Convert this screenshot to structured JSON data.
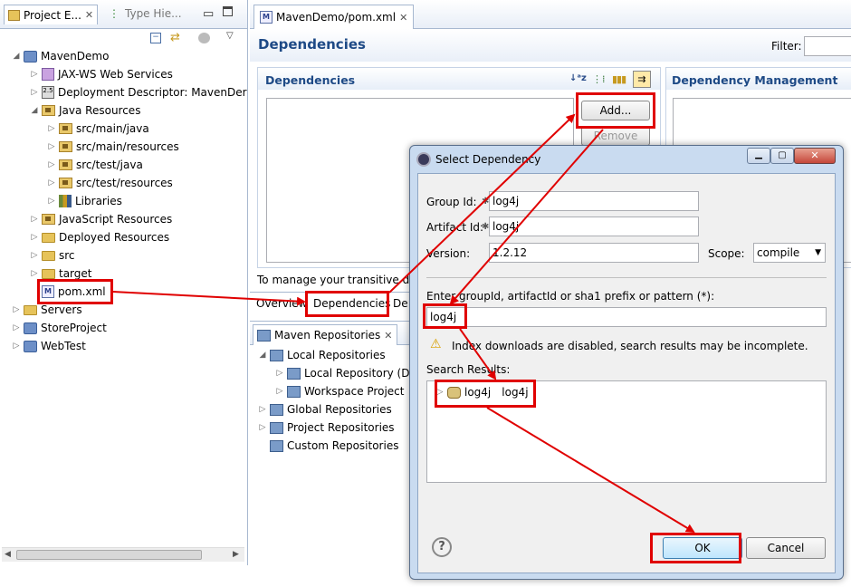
{
  "project_explorer": {
    "tab_label": "Project E...",
    "tab2_label": "Type Hie...",
    "items": [
      {
        "label": "MavenDemo"
      },
      {
        "label": "JAX-WS Web Services"
      },
      {
        "label": "Deployment Descriptor: MavenDer"
      },
      {
        "label": "Java Resources"
      },
      {
        "label": "src/main/java"
      },
      {
        "label": "src/main/resources"
      },
      {
        "label": "src/test/java"
      },
      {
        "label": "src/test/resources"
      },
      {
        "label": "Libraries"
      },
      {
        "label": "JavaScript Resources"
      },
      {
        "label": "Deployed Resources"
      },
      {
        "label": "src"
      },
      {
        "label": "target"
      },
      {
        "label": "pom.xml"
      },
      {
        "label": "Servers"
      },
      {
        "label": "StoreProject"
      },
      {
        "label": "WebTest"
      }
    ]
  },
  "editor": {
    "tab_label": "MavenDemo/pom.xml",
    "page_title": "Dependencies",
    "filter_label": "Filter:",
    "dependencies_section": "Dependencies",
    "dep_mgmt_section": "Dependency Management",
    "add_button": "Add...",
    "remove_button": "Remove",
    "manage_text": "To manage your transitive de",
    "bottom_tabs": [
      "Overview",
      "Dependencies",
      "De"
    ]
  },
  "maven_repos": {
    "tab_label": "Maven Repositories",
    "items": [
      {
        "label": "Local Repositories"
      },
      {
        "label": "Local Repository (D"
      },
      {
        "label": "Workspace Project"
      },
      {
        "label": "Global Repositories"
      },
      {
        "label": "Project Repositories"
      },
      {
        "label": "Custom Repositories"
      }
    ]
  },
  "dialog": {
    "title": "Select Dependency",
    "group_id_label": "Group Id:",
    "group_id_value": "log4j",
    "artifact_id_label": "Artifact Id:",
    "artifact_id_value": "log4j",
    "version_label": "Version:",
    "version_value": "1.2.12",
    "scope_label": "Scope:",
    "scope_value": "compile",
    "query_label": "Enter groupId, artifactId or sha1 prefix or pattern (*):",
    "query_value": "log4j",
    "warning_text": "Index downloads are disabled, search results may be incomplete.",
    "results_label": "Search Results:",
    "result_group": "log4j",
    "result_artifact": "log4j",
    "ok_button": "OK",
    "cancel_button": "Cancel"
  },
  "colors": {
    "annotation_red": "#e00000",
    "section_blue": "#1e4a86"
  }
}
